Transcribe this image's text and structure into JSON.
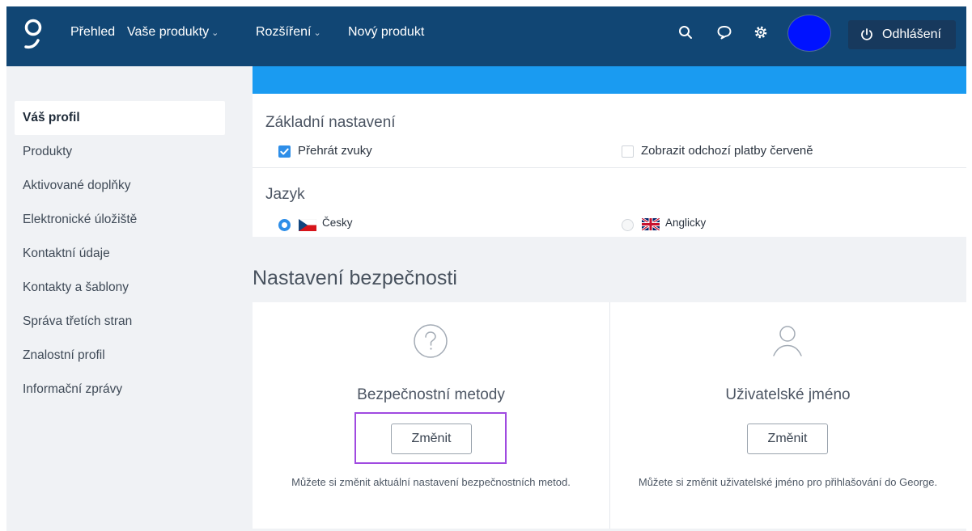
{
  "nav": {
    "overview": "Přehled",
    "products": "Vaše produkty",
    "extensions": "Rozšíření",
    "new_product": "Nový produkt",
    "chevron": "⌄",
    "logout": "Odhlášení"
  },
  "icons": {
    "logo": "george-logo-icon",
    "search": "search-icon",
    "chat": "chat-bubble-icon",
    "settings": "gear-icon",
    "power": "power-icon",
    "question": "question-circle-icon",
    "user": "user-icon"
  },
  "colors": {
    "topbar": "#114674",
    "accent": "#1a9bf1",
    "avatar": "#0012ff",
    "highlight": "#a04ae0"
  },
  "sidebar": {
    "items": [
      {
        "label": "Váš profil",
        "active": true
      },
      {
        "label": "Produkty"
      },
      {
        "label": "Aktivované doplňky"
      },
      {
        "label": "Elektronické úložiště"
      },
      {
        "label": "Kontaktní údaje"
      },
      {
        "label": "Kontakty a šablony"
      },
      {
        "label": "Správa třetích stran"
      },
      {
        "label": "Znalostní profil"
      },
      {
        "label": "Informační zprávy"
      }
    ]
  },
  "basic": {
    "title": "Základní nastavení",
    "sounds": {
      "label": "Přehrát zvuky",
      "checked": true
    },
    "red_payments": {
      "label": "Zobrazit odchozí platby červeně",
      "checked": false
    }
  },
  "language": {
    "title": "Jazyk",
    "czech": {
      "label": "Česky",
      "selected": true
    },
    "english": {
      "label": "Anglicky",
      "selected": false
    }
  },
  "security": {
    "title": "Nastavení bezpečnosti",
    "methods": {
      "title": "Bezpečnostní metody",
      "button": "Změnit",
      "desc": "Můžete si změnit aktuální nastavení bezpečnostních metod."
    },
    "username": {
      "title": "Uživatelské jméno",
      "button": "Změnit",
      "desc": "Můžete si změnit uživatelské jméno pro přihlašování do George."
    }
  }
}
